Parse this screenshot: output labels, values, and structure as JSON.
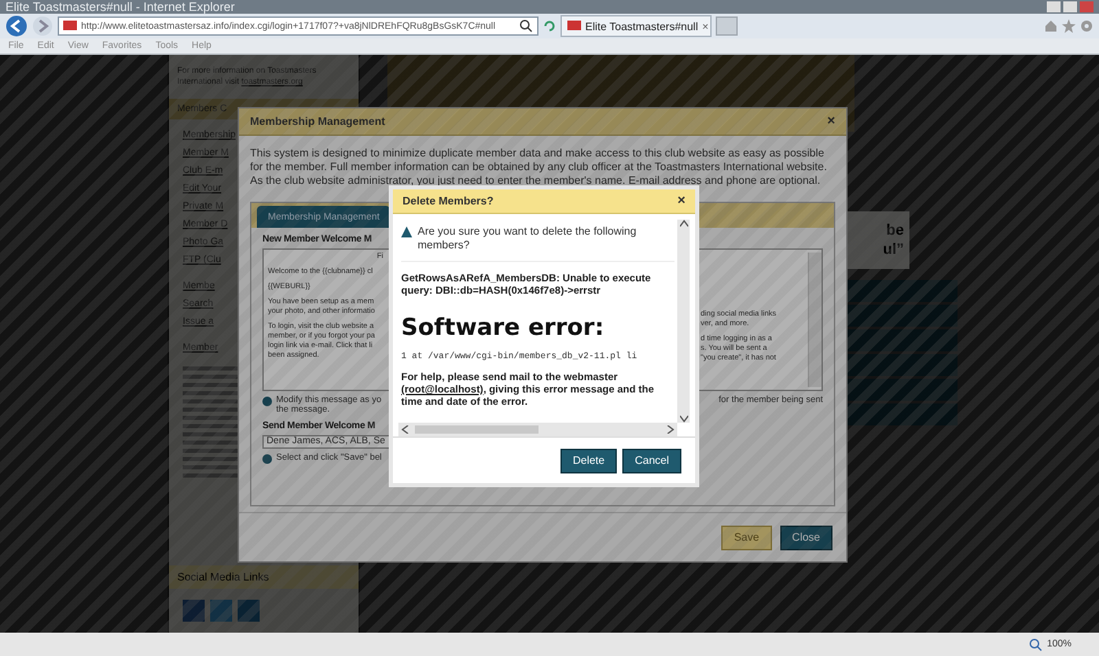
{
  "browser": {
    "title": "Elite Toastmasters#null - Internet Explorer",
    "address": "http://www.elitetoastmastersaz.info/index.cgi/login+1717f07?+va8jNlDREhFQRu8gBsGsK7C#null",
    "tab": "Elite Toastmasters#null",
    "tab_close": "×",
    "menu": [
      "File",
      "Edit",
      "View",
      "Favorites",
      "Tools",
      "Help"
    ],
    "zoom": "100%"
  },
  "sidebar": {
    "info": "For more information on Toastmasters International visit",
    "info_link": "toastmasters.org",
    "heading": "Members C",
    "links": [
      "Membership",
      "Member M",
      "Club E-m",
      "Edit Your",
      "Private M",
      "Member D",
      "Photo Ga",
      "FTP (Clu"
    ],
    "actions": [
      "Membe",
      "Search",
      "Issue a"
    ],
    "list_heading": "Member",
    "social_heading": "Social Media Links"
  },
  "right_text": [
    "be",
    "ul”"
  ],
  "modal": {
    "title": "Membership Management",
    "close": "×",
    "intro": "This system is designed to minimize duplicate member data and make access to this club website as easy as possible for the member. Full member information can be obtained by any club officer at the Toastmasters International website. As the club website administrator, you just need to enter the member's name. E-mail address and phone are optional.",
    "tabs": [
      {
        "label": "Membership Management",
        "selected": true
      }
    ],
    "welcome_heading": "New Member Welcome M",
    "welcome_top": "Fi",
    "welcome_left": [
      [
        "Welcome to the {{clubname}} cl"
      ],
      [
        "{{WEBURL}}"
      ],
      [
        "You have been setup as a mem",
        "your photo, and other informatio"
      ],
      [
        "To login, visit the club website a",
        "member, or if you forgot your pa",
        "login link via e-mail.  Click that li",
        "been assigned."
      ]
    ],
    "welcome_right": [
      [
        "ding social media links",
        "ver, and more."
      ],
      [
        "d time logging in as a",
        "s. You will be sent a",
        "\"you create\", it has not"
      ]
    ],
    "modify_note": "Modify this message as yo",
    "modify_note_right": "for the member being sent",
    "modify_note_end": "the message.",
    "send_heading": "Send Member Welcome M",
    "send_value": "Dene James, ACS, ALB, Se",
    "send_note": "Select and click \"Save\" bel",
    "buttons": [
      {
        "label": "Save",
        "kind": "secondary"
      },
      {
        "label": "Close",
        "kind": "primary"
      }
    ]
  },
  "dialog": {
    "title": "Delete Members?",
    "close": "×",
    "question": "Are you sure you want to delete the following members?",
    "error_query": "GetRowsAsARefA_MembersDB: Unable to execute query: DBI::db=HASH(0x146f7e8)->errstr",
    "error_title": "Software error:",
    "error_trace": "1 at /var/www/cgi-bin/members_db_v2-11.pl li",
    "help_before": "For help, please send mail to the webmaster",
    "help_link": "(root@localhost)",
    "help_after": ", giving this error message and the time and date of the error.",
    "buttons": [
      {
        "label": "Delete",
        "kind": "primary"
      },
      {
        "label": "Cancel",
        "kind": "primary"
      }
    ]
  }
}
